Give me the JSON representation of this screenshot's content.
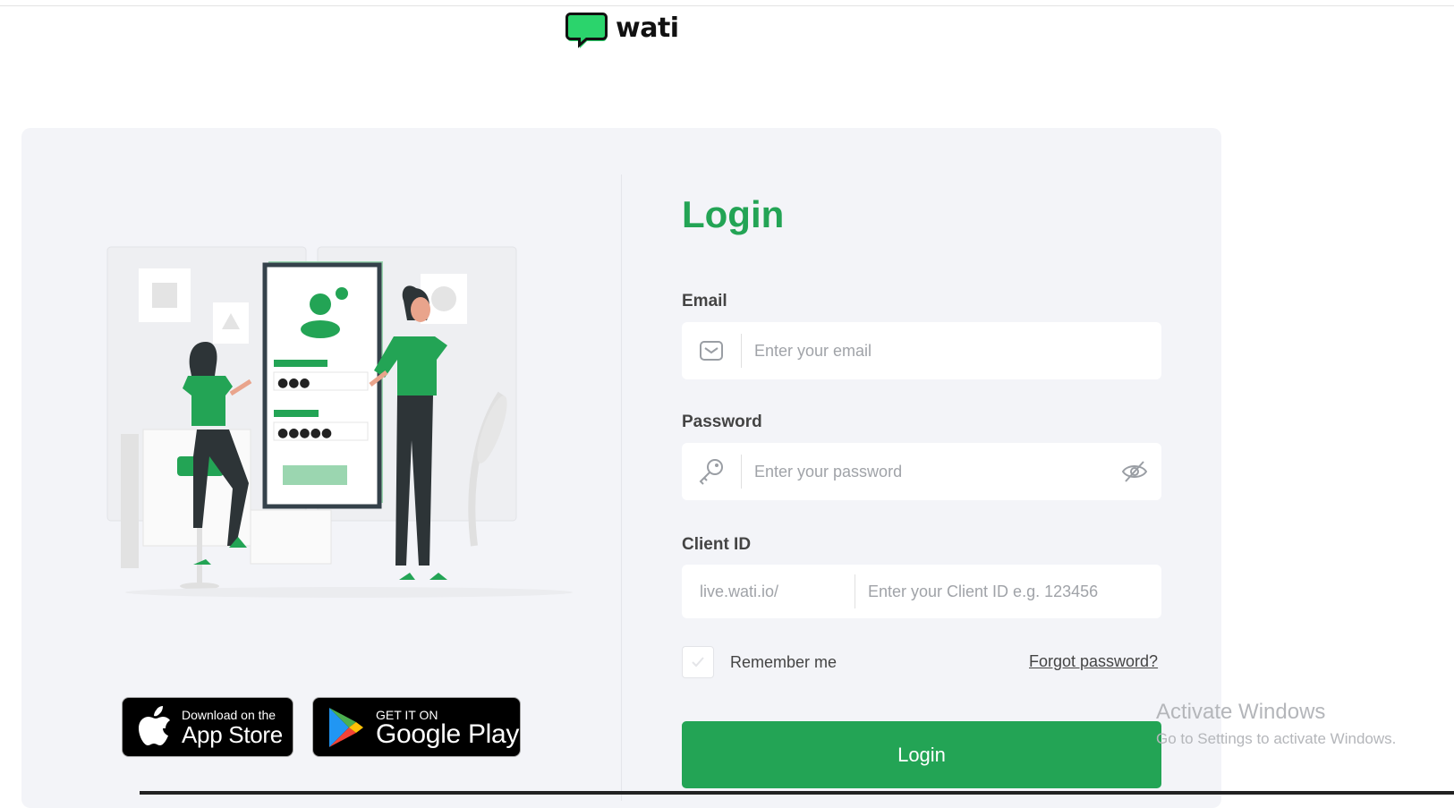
{
  "brand": {
    "name": "wati",
    "accent": "#23a455"
  },
  "illustration": {
    "password_dots_short": "●●●",
    "password_dots_long": "●●●●●"
  },
  "stores": {
    "appstore": {
      "small": "Download on the",
      "big": "App Store"
    },
    "googleplay": {
      "small": "GET IT ON",
      "big": "Google Play"
    }
  },
  "form": {
    "title": "Login",
    "email": {
      "label": "Email",
      "placeholder": "Enter your email",
      "icon": "envelope-icon"
    },
    "password": {
      "label": "Password",
      "placeholder": "Enter your password",
      "icon": "key-icon",
      "toggle_icon": "eye-off-icon"
    },
    "client_id": {
      "label": "Client ID",
      "prefix": "live.wati.io/",
      "placeholder": "Enter your Client ID e.g. 123456"
    },
    "remember_label": "Remember me",
    "forgot_label": "Forgot password?",
    "submit_label": "Login"
  },
  "watermark": {
    "title": "Activate Windows",
    "subtitle": "Go to Settings to activate Windows."
  }
}
